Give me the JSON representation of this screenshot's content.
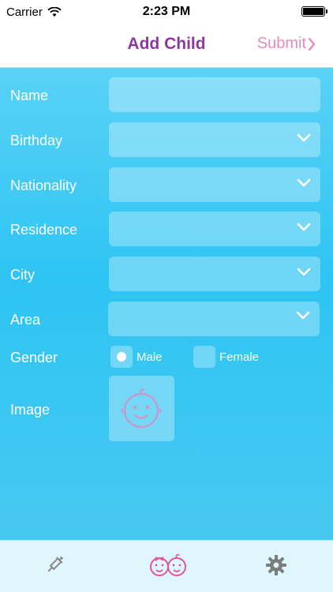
{
  "status_bar": {
    "carrier": "Carrier",
    "time": "2:23 PM"
  },
  "nav": {
    "title": "Add Child",
    "submit_label": "Submit"
  },
  "form": {
    "fields": [
      {
        "label": "Name",
        "value": ""
      },
      {
        "label": "Birthday",
        "value": ""
      },
      {
        "label": "Nationality",
        "value": ""
      },
      {
        "label": "Residence",
        "value": ""
      },
      {
        "label": "City",
        "value": ""
      },
      {
        "label": "Area",
        "value": ""
      }
    ],
    "gender": {
      "label": "Gender",
      "male": "Male",
      "female": "Female",
      "selected": "Male"
    },
    "image": {
      "label": "Image"
    }
  },
  "tabs": [
    {
      "name": "syringe-icon"
    },
    {
      "name": "kids-icon"
    },
    {
      "name": "gear-icon"
    }
  ],
  "colors": {
    "title": "#8a3a9a",
    "submit": "#e58bbf",
    "background": "#2ec4f3",
    "tab_bar": "#dff6fc"
  }
}
